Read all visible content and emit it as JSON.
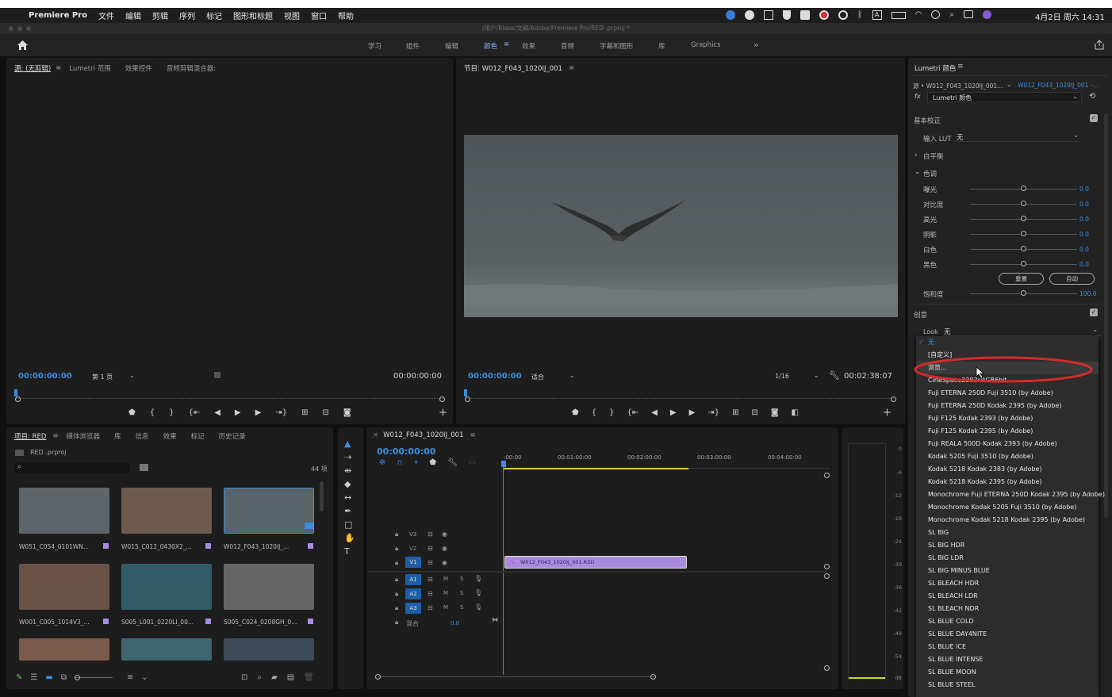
{
  "menubar": {
    "apple": "",
    "app": "Premiere Pro",
    "items": [
      "文件",
      "编辑",
      "剪辑",
      "序列",
      "标记",
      "图形和标题",
      "视图",
      "窗口",
      "帮助"
    ],
    "date": "4月2日 周六 14:31"
  },
  "titlebar": {
    "path": "/用户/Blake/文稿/Adobe/Premiere Pro/RED .prproj *"
  },
  "workspaces": {
    "items": [
      "学习",
      "组件",
      "编辑",
      "颜色",
      "效果",
      "音频",
      "字幕和图形",
      "库",
      "Graphics"
    ],
    "active": "颜色",
    "more": "»"
  },
  "source": {
    "tabs": [
      "源: (无剪辑)",
      "Lumetri 范围",
      "效果控件",
      "音频剪辑混合器:"
    ],
    "timecode": "00:00:00:00",
    "page": "第 1 页",
    "timecode_right": "00:00:00:00"
  },
  "program": {
    "tab": "节目: W012_F043_1020IJ_001",
    "timecode": "00:00:00:00",
    "fit": "适合",
    "res": "1/16",
    "duration": "00:02:38:07"
  },
  "project": {
    "tabs": [
      "项目: RED",
      "媒体浏览器",
      "库",
      "信息",
      "效果",
      "标记",
      "历史记录"
    ],
    "file": "RED .prproj",
    "count": "44 项",
    "items": [
      {
        "name": "W051_C054_0101WN...",
        "color": "#5d646a"
      },
      {
        "name": "W015_C012_0430X2_...",
        "color": "#6e5a4d"
      },
      {
        "name": "W012_F043_1020IJ_...",
        "color": "#59636a"
      },
      {
        "name": "W001_C005_1014V3_...",
        "color": "#6a5346"
      },
      {
        "name": "S005_L001_0220LI_00...",
        "color": "#2f5c66"
      },
      {
        "name": "S005_C024_0208GH_0...",
        "color": "#666"
      }
    ]
  },
  "timeline": {
    "tab": "W012_F043_1020IJ_001",
    "timecode": "00:00:00:00",
    "ruler": [
      ":00:00",
      "00:01:00:00",
      "00:02:00:00",
      "00:03:00:00",
      "00:04:00:00"
    ],
    "video_tracks": [
      "V3",
      "V2",
      "V1"
    ],
    "audio_tracks": [
      "A1",
      "A2",
      "A3"
    ],
    "mix_label": "混合",
    "mix_value": "0.0",
    "clip": "W012_F043_1020IJ_001.R3D"
  },
  "meter": {
    "ticks": [
      "0",
      "-6",
      "-12",
      "-18",
      "-24",
      "-30",
      "-36",
      "-42",
      "-48",
      "-54",
      "dB"
    ]
  },
  "lumetri": {
    "title": "Lumetri 颜色",
    "source": "源 • W012_F043_1020IJ_001...",
    "target": "W012_F043_1020IJ_001 -...",
    "effect": "Lumetri 颜色",
    "basic": "基本校正",
    "input_lut_label": "输入 LUT",
    "input_lut_value": "无",
    "white_balance": "白平衡",
    "tone": "色调",
    "sliders": [
      {
        "label": "曝光",
        "value": "0.0"
      },
      {
        "label": "对比度",
        "value": "0.0"
      },
      {
        "label": "高光",
        "value": "0.0"
      },
      {
        "label": "阴影",
        "value": "0.0"
      },
      {
        "label": "白色",
        "value": "0.0"
      },
      {
        "label": "黑色",
        "value": "0.0"
      }
    ],
    "reset": "重置",
    "auto": "自动",
    "saturation_label": "饱和度",
    "saturation_value": "100.0",
    "creative": "创意",
    "look_label": "Look",
    "look_value": "无"
  },
  "dropdown": {
    "checked": "无",
    "items": [
      "[自定义]",
      "浏览...",
      "CineSpace2383sRGB6bit",
      "Fuji ETERNA 250D Fuji 3510 (by Adobe)",
      "Fuji ETERNA 250D Kodak 2395 (by Adobe)",
      "Fuji F125 Kodak 2393 (by Adobe)",
      "Fuji F125 Kodak 2395 (by Adobe)",
      "Fuji REALA 500D Kodak 2393 (by Adobe)",
      "Kodak 5205 Fuji 3510 (by Adobe)",
      "Kodak 5218 Kodak 2383 (by Adobe)",
      "Kodak 5218 Kodak 2395 (by Adobe)",
      "Monochrome Fuji ETERNA 250D Kodak 2395 (by Adobe)",
      "Monochrome Kodak 5205 Fuji 3510 (by Adobe)",
      "Monochrome Kodak 5218 Kodak 2395 (by Adobe)",
      "SL BIG",
      "SL BIG HDR",
      "SL BIG LDR",
      "SL BIG MINUS BLUE",
      "SL BLEACH HDR",
      "SL BLEACH LDR",
      "SL BLEACH NDR",
      "SL BLUE COLD",
      "SL BLUE DAY4NITE",
      "SL BLUE ICE",
      "SL BLUE INTENSE",
      "SL BLUE MOON",
      "SL BLUE STEEL"
    ],
    "highlight": "#d42a2a"
  }
}
